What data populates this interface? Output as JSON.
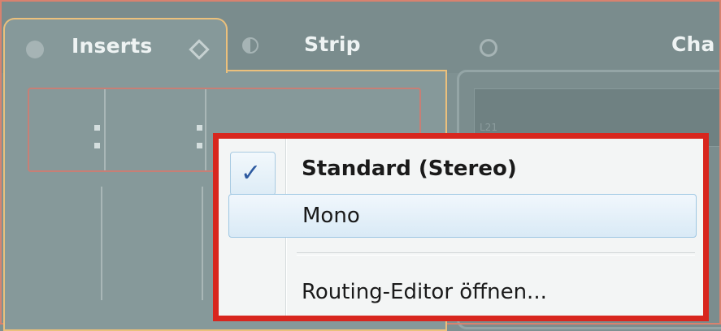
{
  "tabs": [
    {
      "label": "Inserts",
      "active": true
    },
    {
      "label": "Strip",
      "active": false
    },
    {
      "label": "Cha",
      "active": false
    }
  ],
  "panel_right": {
    "faint_text": "L21"
  },
  "context_menu": {
    "items": [
      {
        "label": "Standard (Stereo)",
        "checked": true
      },
      {
        "label": "Mono",
        "hovered": true
      },
      {
        "label": "Routing-Editor öffnen..."
      }
    ]
  },
  "colors": {
    "highlight_border": "#d8261e",
    "active_tab_border": "#ebc07c",
    "check_mark": "#2d5aa0"
  },
  "icons": [
    "dot-icon",
    "diamond-icon",
    "half-circle-icon",
    "ring-icon",
    "check-icon"
  ]
}
